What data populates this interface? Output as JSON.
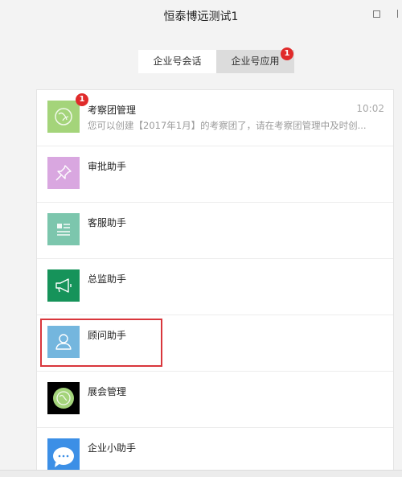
{
  "window": {
    "title": "恒泰博远测试1"
  },
  "tabs": [
    {
      "label": "企业号会话",
      "active": false
    },
    {
      "label": "企业号应用",
      "active": true,
      "badge": "1"
    }
  ],
  "apps": [
    {
      "name": "考察团管理",
      "time": "10:02",
      "message": "您可以创建【2017年1月】的考察团了，请在考察团管理中及时创...",
      "badge": "1",
      "icon": "globe-icon",
      "color": "#a4d47a"
    },
    {
      "name": "审批助手",
      "icon": "pushpin-icon",
      "color": "#d9a7e0"
    },
    {
      "name": "客服助手",
      "icon": "document-icon",
      "color": "#7cc6ad"
    },
    {
      "name": "总监助手",
      "icon": "megaphone-icon",
      "color": "#16935a"
    },
    {
      "name": "顾问助手",
      "icon": "person-icon",
      "color": "#74b6de",
      "highlighted": true
    },
    {
      "name": "展会管理",
      "icon": "globe-icon",
      "color": "#000000"
    },
    {
      "name": "企业小助手",
      "icon": "chat-bubble-icon",
      "color": "#3c8fe6"
    }
  ]
}
